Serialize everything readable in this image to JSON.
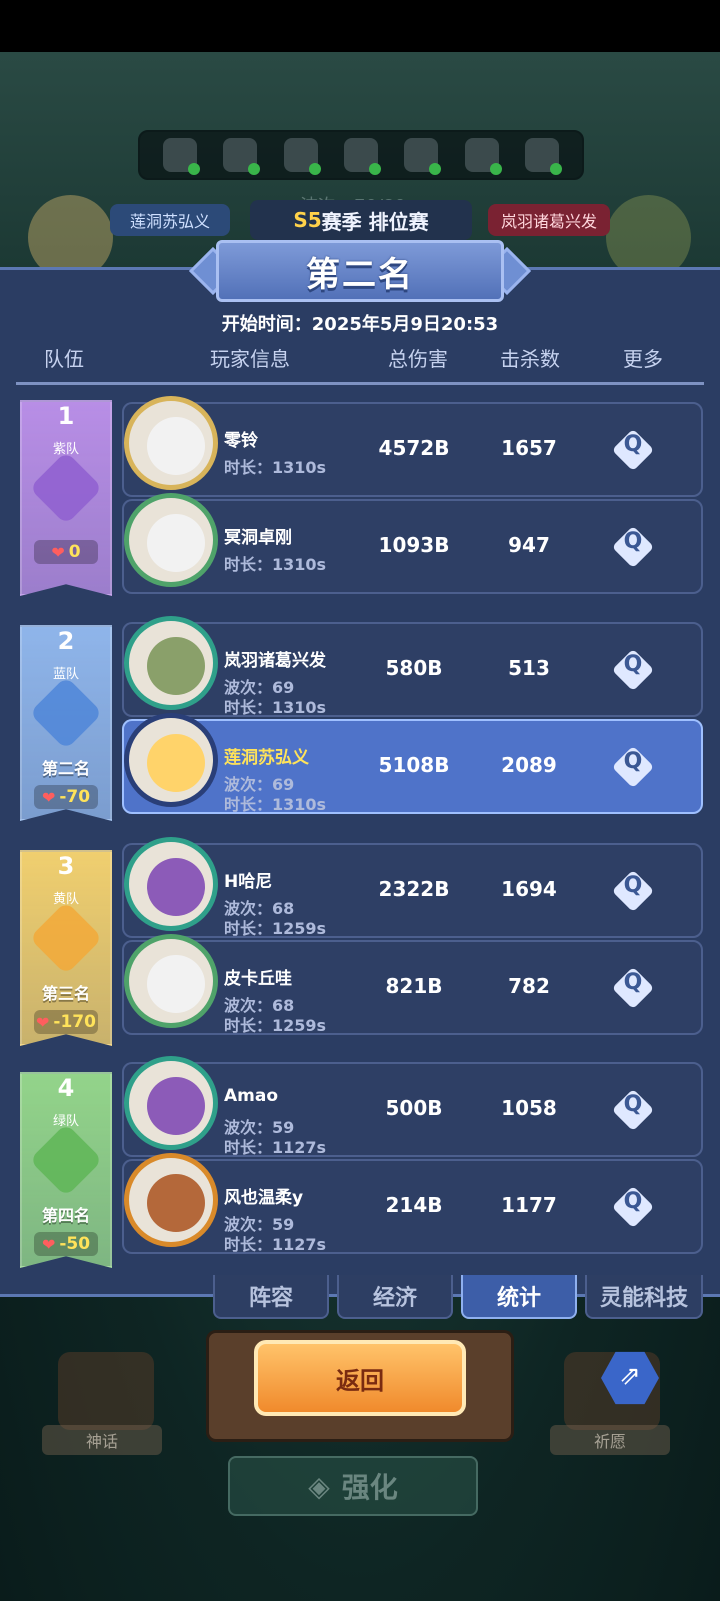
{
  "background": {
    "wave_text": "波次：70/80",
    "left_player_tag": "莲洞苏弘义",
    "right_player_tag": "岚羽诸葛兴发"
  },
  "season": {
    "prefix": "S5",
    "label": "赛季 排位赛"
  },
  "result": {
    "title": "第二名",
    "start_time_label": "开始时间：",
    "start_time": "2025年5月9日20:53"
  },
  "columns": {
    "team": "队伍",
    "player": "玩家信息",
    "damage": "总伤害",
    "kills": "击杀数",
    "more": "更多"
  },
  "teams": [
    {
      "rank_num": "1",
      "name": "紫队",
      "rank_label": "",
      "score": "0",
      "color": "#b88ee6",
      "emblem": "#8f5fd0"
    },
    {
      "rank_num": "2",
      "name": "蓝队",
      "rank_label": "第二名",
      "score": "-70",
      "color": "#8fb5ea",
      "emblem": "#4f86d8"
    },
    {
      "rank_num": "3",
      "name": "黄队",
      "rank_label": "第三名",
      "score": "-170",
      "color": "#f0cf6f",
      "emblem": "#f2a93a"
    },
    {
      "rank_num": "4",
      "name": "绿队",
      "rank_label": "第四名",
      "score": "-50",
      "color": "#93d48a",
      "emblem": "#5fb657"
    }
  ],
  "players": [
    {
      "name": "零铃",
      "wave": "",
      "time": "时长：1310s",
      "damage": "4572B",
      "kills": "1657",
      "me": false,
      "ring": "#d8b45a",
      "face": "#f2f2f2"
    },
    {
      "name": "冥洞卓刚",
      "wave": "",
      "time": "时长：1310s",
      "damage": "1093B",
      "kills": "947",
      "me": false,
      "ring": "#4fa36a",
      "face": "#f2f2f2"
    },
    {
      "name": "岚羽诸葛兴发",
      "wave": "波次：69",
      "time": "时长：1310s",
      "damage": "580B",
      "kills": "513",
      "me": false,
      "ring": "#2fa08a",
      "face": "#8aa06a"
    },
    {
      "name": "莲洞苏弘义",
      "wave": "波次：69",
      "time": "时长：1310s",
      "damage": "5108B",
      "kills": "2089",
      "me": true,
      "ring": "#2a3f78",
      "face": "#ffd36a"
    },
    {
      "name": "H哈尼",
      "wave": "波次：68",
      "time": "时长：1259s",
      "damage": "2322B",
      "kills": "1694",
      "me": false,
      "ring": "#2fa08a",
      "face": "#8c5bb8"
    },
    {
      "name": "皮卡丘哇",
      "wave": "波次：68",
      "time": "时长：1259s",
      "damage": "821B",
      "kills": "782",
      "me": false,
      "ring": "#4fa36a",
      "face": "#f2f2f2"
    },
    {
      "name": "Amao",
      "wave": "波次：59",
      "time": "时长：1127s",
      "damage": "500B",
      "kills": "1058",
      "me": false,
      "ring": "#2fa08a",
      "face": "#8c5bb8"
    },
    {
      "name": "风也温柔y",
      "wave": "波次：59",
      "time": "时长：1127s",
      "damage": "214B",
      "kills": "1177",
      "me": false,
      "ring": "#d98a2a",
      "face": "#b4683a"
    }
  ],
  "tabs": [
    "阵容",
    "经济",
    "统计",
    "灵能科技"
  ],
  "active_tab": "统计",
  "back_button": "返回",
  "ghost_buttons": {
    "left": "神话",
    "right": "祈愿",
    "bottom": "强化"
  },
  "icons": {
    "more": "search-icon",
    "share": "share-icon",
    "heart": "heart-icon"
  }
}
